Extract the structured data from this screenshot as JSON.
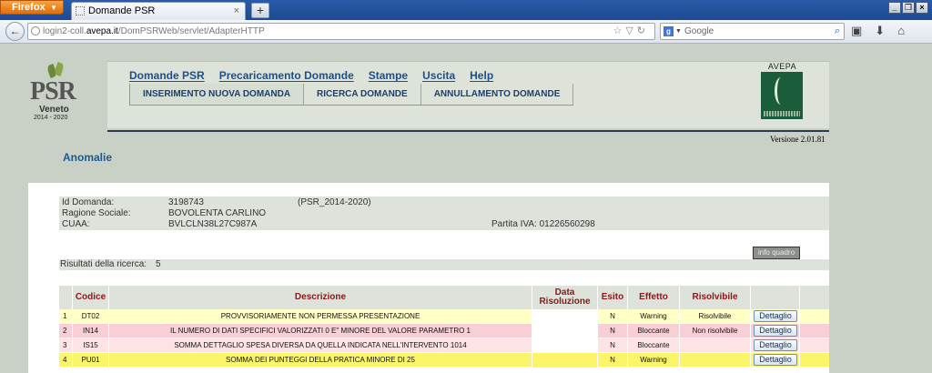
{
  "browser": {
    "app_button": "Firefox",
    "tab_title": "Domande PSR",
    "url_prefix": "login2-coll.",
    "url_domain": "avepa.it",
    "url_path": "/DomPSRWeb/servlet/AdapterHTTP",
    "search_placeholder": "Google"
  },
  "logo": {
    "psr": "PSR",
    "region": "Veneto",
    "years": "2014 - 2020"
  },
  "menu": {
    "top": [
      "Domande PSR",
      "Precaricamento Domande",
      "Stampe",
      "Uscita",
      "Help"
    ],
    "sub": [
      "INSERIMENTO NUOVA DOMANDA",
      "RICERCA DOMANDE",
      "ANNULLAMENTO DOMANDE"
    ]
  },
  "avepa": {
    "name": "AVEPA"
  },
  "version": "Versione 2.01.81",
  "page_title": "Anomalie",
  "info": {
    "id_label": "Id Domanda:",
    "id_value": "3198743",
    "program": "(PSR_2014-2020)",
    "ragione_label": "Ragione Sociale:",
    "ragione_value": "BOVOLENTA CARLINO",
    "cuaa_label": "CUAA:",
    "cuaa_value": "BVLCLN38L27C987A",
    "piva": "Partita IVA: 01226560298"
  },
  "info_quadro": "info quadro",
  "results": {
    "label": "Risultati della ricerca:",
    "count": "5"
  },
  "table": {
    "headers": [
      "Codice",
      "Descrizione",
      "Data Risoluzione",
      "Esito",
      "Effetto",
      "Risolvibile"
    ],
    "rows": [
      {
        "n": "1",
        "codice": "DT02",
        "descrizione": "PROVVISORIAMENTE NON PERMESSA PRESENTAZIONE",
        "data": "",
        "esito": "N",
        "effetto": "Warning",
        "risolvibile": "Risolvibile",
        "button": "Dettaglio"
      },
      {
        "n": "2",
        "codice": "IN14",
        "descrizione": "IL NUMERO DI DATI SPECIFICI VALORIZZATI 0 E\" MINORE DEL VALORE PARAMETRO 1",
        "data": "",
        "esito": "N",
        "effetto": "Bloccante",
        "risolvibile": "Non risolvibile",
        "button": "Dettaglio"
      },
      {
        "n": "3",
        "codice": "IS15",
        "descrizione": "SOMMA DETTAGLIO SPESA DIVERSA DA QUELLA INDICATA NELL'INTERVENTO 1014",
        "data": "",
        "esito": "N",
        "effetto": "Bloccante",
        "risolvibile": "",
        "button": "Dettaglio"
      },
      {
        "n": "4",
        "codice": "PU01",
        "descrizione": "SOMMA DEI PUNTEGGI DELLA PRATICA MINORE DI 25",
        "data": "",
        "esito": "N",
        "effetto": "Warning",
        "risolvibile": "",
        "button": "Dettaglio"
      }
    ]
  }
}
